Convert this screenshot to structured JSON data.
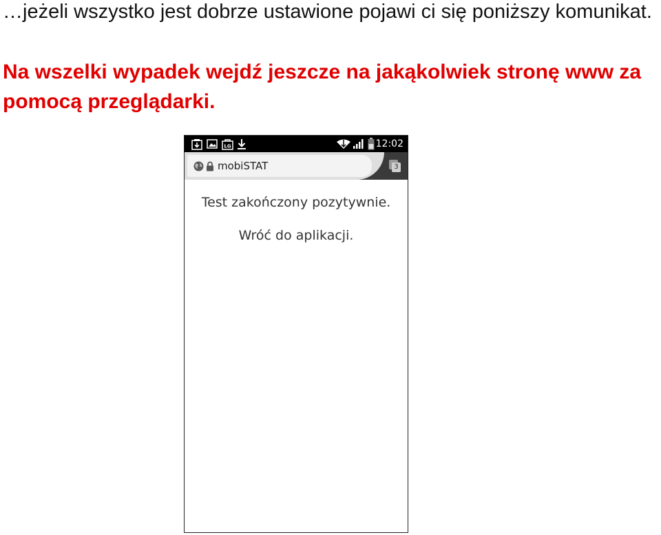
{
  "slide": {
    "intro_text": "…jeżeli wszystko jest dobrze ustawione pojawi ci się poniższy komunikat.",
    "notice_text": "Na wszelki wypadek wejdź jeszcze na jakąkolwiek stronę www za pomocą przeglądarki.",
    "notice_color": "#e00000"
  },
  "phone": {
    "status_bar": {
      "time": "12:02",
      "left_icons": [
        "download-notification-icon",
        "image-notification-icon",
        "lg-notification-icon",
        "download-arrow-icon"
      ],
      "right_icons": [
        "wifi-icon",
        "signal-bars-icon",
        "battery-icon"
      ]
    },
    "browser": {
      "address_text": "mobiSTAT",
      "tab_count": "3",
      "page_line_1": "Test zakończony pozytywnie.",
      "page_line_2": "Wróć do aplikacji."
    }
  }
}
